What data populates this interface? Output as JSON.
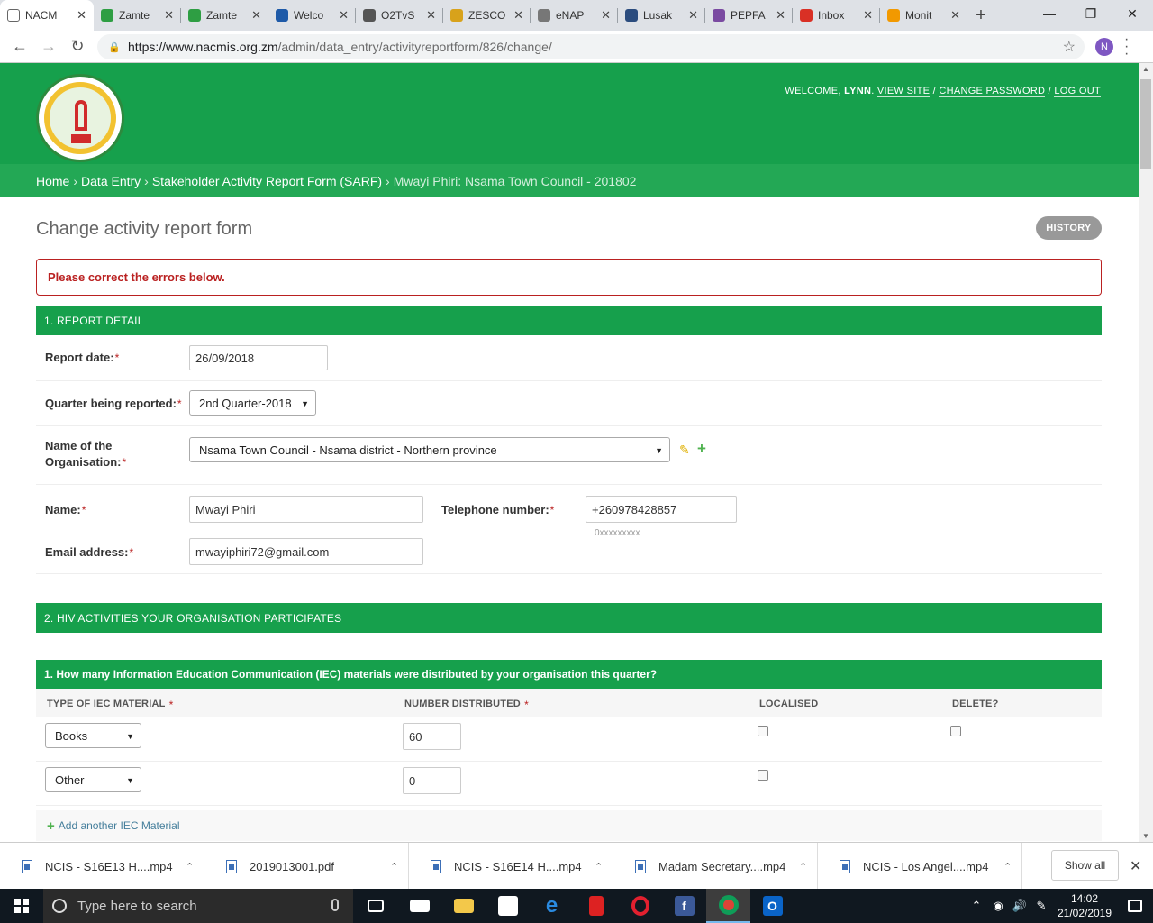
{
  "browser": {
    "tabs": [
      {
        "title": "NACM",
        "color": "#ffffff",
        "active": true
      },
      {
        "title": "Zamte",
        "color": "#2e9e43"
      },
      {
        "title": "Zamte",
        "color": "#2e9e43"
      },
      {
        "title": "Welco",
        "color": "#1e5aa8"
      },
      {
        "title": "O2TvS",
        "color": "#555555"
      },
      {
        "title": "ZESCO",
        "color": "#d8a21b"
      },
      {
        "title": "eNAP",
        "color": "#777777"
      },
      {
        "title": "Lusak",
        "color": "#2b4c7e"
      },
      {
        "title": "PEPFA",
        "color": "#7a4aa1"
      },
      {
        "title": "Inbox",
        "color": "#d93025"
      },
      {
        "title": "Monit",
        "color": "#f29900"
      }
    ],
    "tab_close": "✕",
    "new_tab": "+",
    "url_host": "https://www.nacmis.org.zm",
    "url_path": "/admin/data_entry/activityreportform/826/change/",
    "profile_initial": "N"
  },
  "header": {
    "welcome": "WELCOME,",
    "user": "LYNN",
    "view_site": "VIEW SITE",
    "change_password": "CHANGE PASSWORD",
    "log_out": "LOG OUT",
    "sep": "/"
  },
  "breadcrumbs": {
    "home": "Home",
    "data_entry": "Data Entry",
    "form_list": "Stakeholder Activity Report Form (SARF)",
    "current": "Mwayi Phiri: Nsama Town Council - 201802",
    "sep": "›"
  },
  "page": {
    "title": "Change activity report form",
    "history": "HISTORY",
    "error": "Please correct the errors below."
  },
  "section1": {
    "heading": "1. REPORT DETAIL",
    "report_date_label": "Report date:",
    "report_date_value": "26/09/2018",
    "quarter_label": "Quarter being reported:",
    "quarter_value": "2nd Quarter-2018",
    "org_label_1": "Name of the",
    "org_label_2": "Organisation:",
    "org_value": "Nsama Town Council - Nsama district - Northern province",
    "name_label": "Name:",
    "name_value": "Mwayi Phiri",
    "phone_label": "Telephone number:",
    "phone_value": "+260978428857",
    "phone_help": "0xxxxxxxxx",
    "email_label": "Email address:",
    "email_value": "mwayiphiri72@gmail.com",
    "required_mark": "*"
  },
  "section2": {
    "heading": "2. HIV ACTIVITIES YOUR ORGANISATION PARTICIPATES"
  },
  "iec": {
    "heading": "1. How many Information Education Communication (IEC) materials were distributed by your organisation this quarter?",
    "col_type": "TYPE OF IEC MATERIAL",
    "col_number": "NUMBER DISTRIBUTED",
    "col_localised": "LOCALISED",
    "col_delete": "DELETE?",
    "rows": [
      {
        "type": "Books",
        "number": "60"
      },
      {
        "type": "Other",
        "number": "0"
      }
    ],
    "add_label": "Add another IEC Material"
  },
  "downloads": {
    "items": [
      "NCIS - S16E13 H....mp4",
      "2019013001.pdf",
      "NCIS - S16E14 H....mp4",
      "Madam Secretary....mp4",
      "NCIS - Los Angel....mp4"
    ],
    "show_all": "Show all"
  },
  "taskbar": {
    "search_placeholder": "Type here to search",
    "time": "14:02",
    "date": "21/02/2019"
  }
}
